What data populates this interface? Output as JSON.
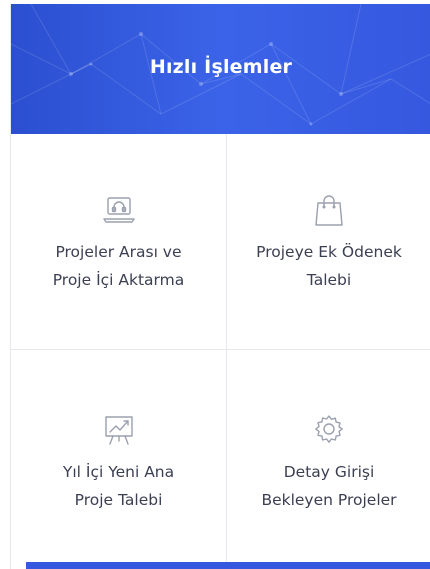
{
  "header": {
    "title": "Hızlı İşlemler"
  },
  "tiles": [
    {
      "icon": "laptop-support-icon",
      "line1": "Projeler Arası ve",
      "line2": "Proje İçi Aktarma"
    },
    {
      "icon": "shopping-bag-icon",
      "line1": "Projeye Ek Ödenek",
      "line2": "Talebi"
    },
    {
      "icon": "presentation-chart-icon",
      "line1": "Yıl İçi Yeni Ana",
      "line2": "Proje Talebi"
    },
    {
      "icon": "gear-icon",
      "line1": "Detay Girişi",
      "line2": "Bekleyen Projeler"
    }
  ],
  "colors": {
    "header_bg": "#3558df",
    "text": "#3b3f52",
    "icon": "#9aa0ad",
    "border": "#e6e8ee"
  }
}
